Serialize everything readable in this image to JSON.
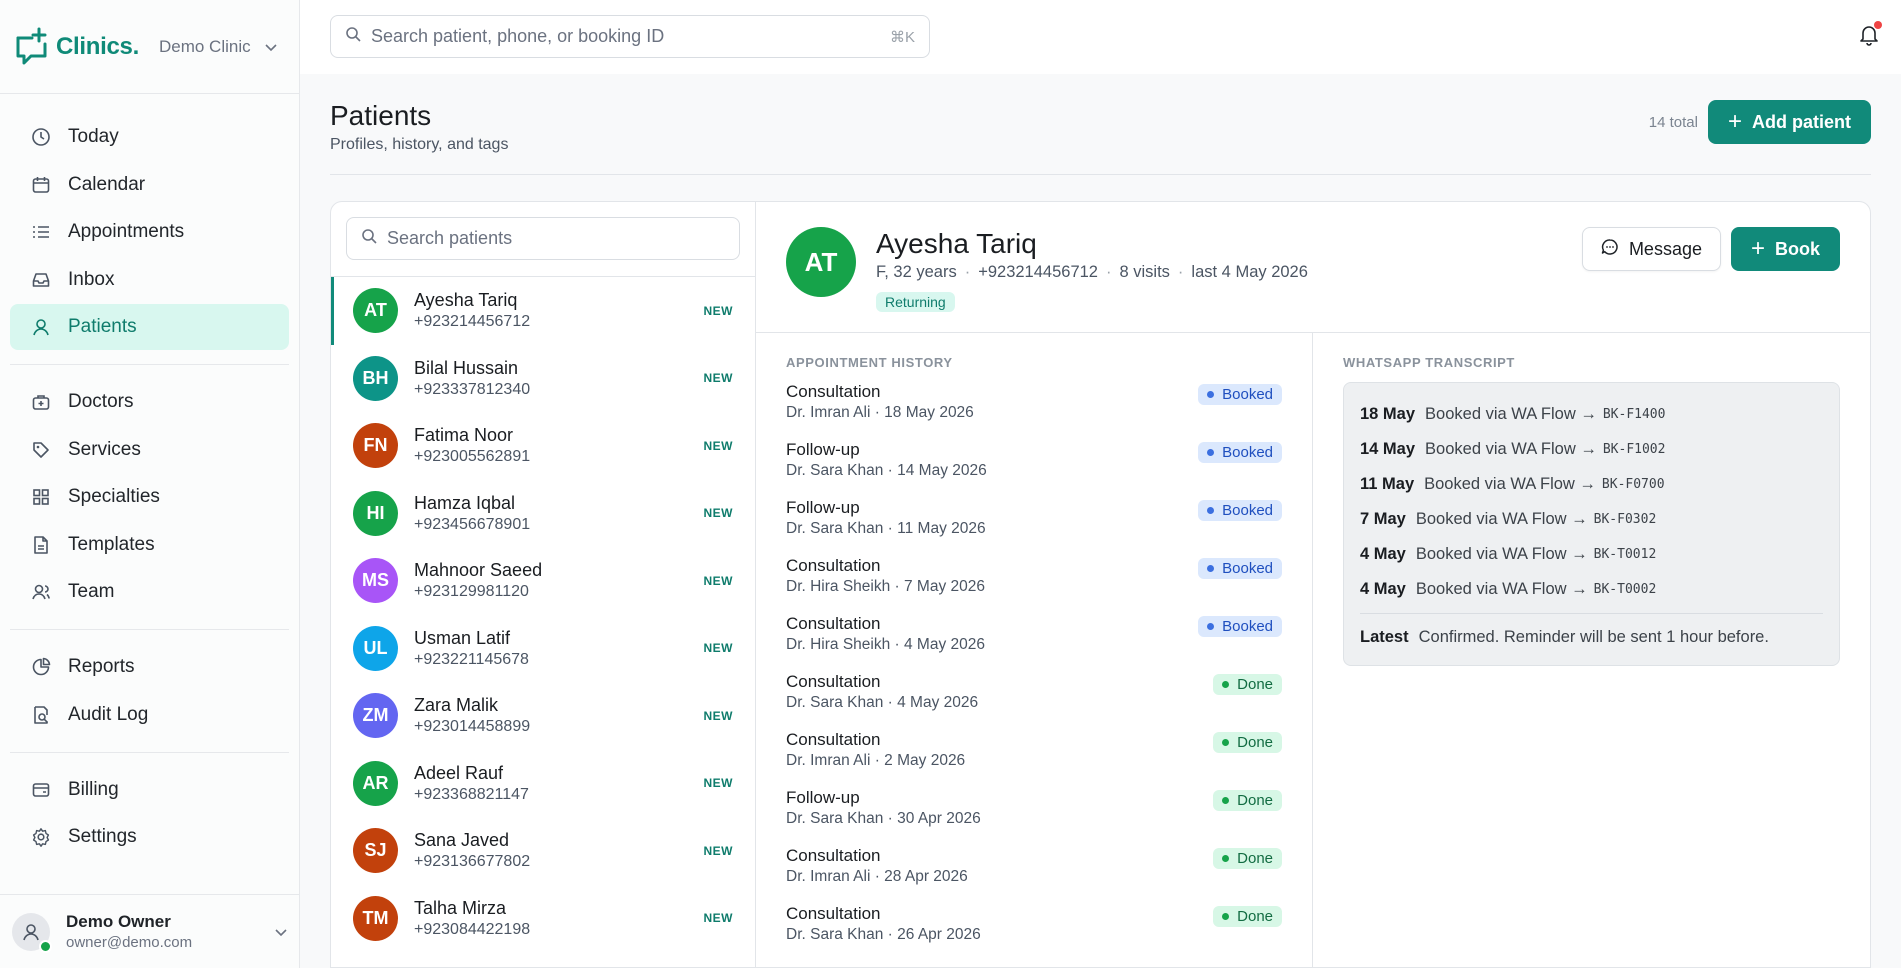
{
  "brand": {
    "logo_text": "Clinics.",
    "clinic_name": "Demo Clinic"
  },
  "search": {
    "placeholder": "Search patient, phone, or booking ID",
    "shortcut": "⌘K"
  },
  "nav": {
    "group1": [
      {
        "label": "Today",
        "icon": "clock-icon"
      },
      {
        "label": "Calendar",
        "icon": "calendar-icon"
      },
      {
        "label": "Appointments",
        "icon": "list-icon"
      },
      {
        "label": "Inbox",
        "icon": "inbox-icon"
      },
      {
        "label": "Patients",
        "icon": "user-icon",
        "active": true
      }
    ],
    "group2": [
      {
        "label": "Doctors",
        "icon": "medical-bag-icon"
      },
      {
        "label": "Services",
        "icon": "tag-icon"
      },
      {
        "label": "Specialties",
        "icon": "grid-icon"
      },
      {
        "label": "Templates",
        "icon": "file-icon"
      },
      {
        "label": "Team",
        "icon": "team-icon"
      }
    ],
    "group3": [
      {
        "label": "Reports",
        "icon": "pie-chart-icon"
      },
      {
        "label": "Audit Log",
        "icon": "audit-icon"
      }
    ],
    "group4": [
      {
        "label": "Billing",
        "icon": "wallet-icon"
      },
      {
        "label": "Settings",
        "icon": "gear-icon"
      }
    ]
  },
  "user": {
    "name": "Demo Owner",
    "email": "owner@demo.com"
  },
  "page": {
    "title": "Patients",
    "subtitle": "Profiles, history, and tags",
    "total": "14 total",
    "add_label": "Add patient"
  },
  "list": {
    "search_placeholder": "Search patients",
    "patients": [
      {
        "initials": "AT",
        "name": "Ayesha Tariq",
        "phone": "+923214456712",
        "badge": "NEW",
        "color": "#16a34a",
        "active": true
      },
      {
        "initials": "BH",
        "name": "Bilal Hussain",
        "phone": "+923337812340",
        "badge": "NEW",
        "color": "#0d9488"
      },
      {
        "initials": "FN",
        "name": "Fatima Noor",
        "phone": "+923005562891",
        "badge": "NEW",
        "color": "#c2410c"
      },
      {
        "initials": "HI",
        "name": "Hamza Iqbal",
        "phone": "+923456678901",
        "badge": "NEW",
        "color": "#16a34a"
      },
      {
        "initials": "MS",
        "name": "Mahnoor Saeed",
        "phone": "+923129981120",
        "badge": "NEW",
        "color": "#a855f7"
      },
      {
        "initials": "UL",
        "name": "Usman Latif",
        "phone": "+923221145678",
        "badge": "NEW",
        "color": "#0ea5e9"
      },
      {
        "initials": "ZM",
        "name": "Zara Malik",
        "phone": "+923014458899",
        "badge": "NEW",
        "color": "#6366f1"
      },
      {
        "initials": "AR",
        "name": "Adeel Rauf",
        "phone": "+923368821147",
        "badge": "NEW",
        "color": "#16a34a"
      },
      {
        "initials": "SJ",
        "name": "Sana Javed",
        "phone": "+923136677802",
        "badge": "NEW",
        "color": "#c2410c"
      },
      {
        "initials": "TM",
        "name": "Talha Mirza",
        "phone": "+923084422198",
        "badge": "NEW",
        "color": "#c2410c"
      }
    ]
  },
  "detail": {
    "initials": "AT",
    "name": "Ayesha Tariq",
    "gender_age": "F, 32 years",
    "phone": "+923214456712",
    "visits": "8 visits",
    "last": "last 4 May 2026",
    "tag": "Returning",
    "message_label": "Message",
    "book_label": "Book"
  },
  "history": {
    "title": "APPOINTMENT HISTORY",
    "items": [
      {
        "type": "Consultation",
        "sub": "Dr. Imran Ali · 18 May 2026",
        "status": "Booked"
      },
      {
        "type": "Follow-up",
        "sub": "Dr. Sara Khan · 14 May 2026",
        "status": "Booked"
      },
      {
        "type": "Follow-up",
        "sub": "Dr. Sara Khan · 11 May 2026",
        "status": "Booked"
      },
      {
        "type": "Consultation",
        "sub": "Dr. Hira Sheikh · 7 May 2026",
        "status": "Booked"
      },
      {
        "type": "Consultation",
        "sub": "Dr. Hira Sheikh · 4 May 2026",
        "status": "Booked"
      },
      {
        "type": "Consultation",
        "sub": "Dr. Sara Khan · 4 May 2026",
        "status": "Done"
      },
      {
        "type": "Consultation",
        "sub": "Dr. Imran Ali · 2 May 2026",
        "status": "Done"
      },
      {
        "type": "Follow-up",
        "sub": "Dr. Sara Khan · 30 Apr 2026",
        "status": "Done"
      },
      {
        "type": "Consultation",
        "sub": "Dr. Imran Ali · 28 Apr 2026",
        "status": "Done"
      },
      {
        "type": "Consultation",
        "sub": "Dr. Sara Khan · 26 Apr 2026",
        "status": "Done"
      }
    ]
  },
  "whatsapp": {
    "title": "WHATSAPP TRANSCRIPT",
    "rows": [
      {
        "date": "18 May",
        "text": "Booked via WA Flow →",
        "code": "BK-F1400"
      },
      {
        "date": "14 May",
        "text": "Booked via WA Flow →",
        "code": "BK-F1002"
      },
      {
        "date": "11 May",
        "text": "Booked via WA Flow →",
        "code": "BK-F0700"
      },
      {
        "date": "7 May",
        "text": "Booked via WA Flow →",
        "code": "BK-F0302"
      },
      {
        "date": "4 May",
        "text": "Booked via WA Flow →",
        "code": "BK-T0012"
      },
      {
        "date": "4 May",
        "text": "Booked via WA Flow →",
        "code": "BK-T0002"
      }
    ],
    "latest_label": "Latest",
    "latest_text": "Confirmed. Reminder will be sent 1 hour before."
  }
}
